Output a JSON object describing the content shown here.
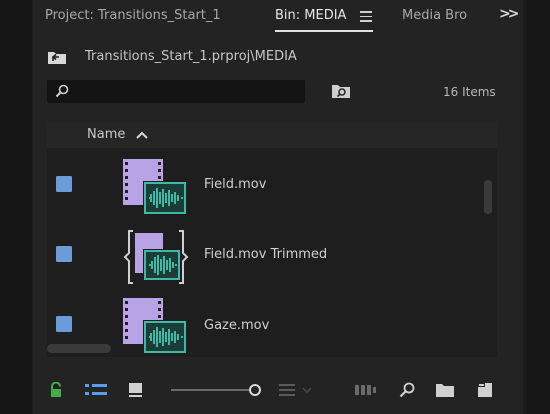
{
  "tabs": [
    {
      "label": "Project: Transitions_Start_1"
    },
    {
      "label": "Bin: MEDIA"
    },
    {
      "label": "Media Bro"
    }
  ],
  "path": "Transitions_Start_1.prproj\\MEDIA",
  "search": {
    "value": "",
    "placeholder": ""
  },
  "items_count": "16 Items",
  "list": {
    "column_name": "Name",
    "rows": [
      {
        "name": "Field.mov",
        "label_color": "#6b9bd8",
        "type": "clip"
      },
      {
        "name": "Field.mov Trimmed",
        "label_color": "#6b9bd8",
        "type": "trimmed"
      },
      {
        "name": "Gaze.mov",
        "label_color": "#6b9bd8",
        "type": "clip"
      }
    ]
  },
  "colors": {
    "video": "#b7a3e6",
    "audio": "#3fb9a6",
    "accent_green": "#3fae4b",
    "accent_blue": "#5b9cf0"
  },
  "icons": {
    "lock": "lock-icon",
    "list_view": "list-view-icon",
    "icon_view": "icon-view-icon",
    "zoom_slider": "zoom-slider",
    "sort": "sort-icon",
    "automate": "automate-to-sequence-icon",
    "find": "find-icon",
    "new_bin": "new-bin-icon",
    "new_item": "new-item-icon"
  }
}
